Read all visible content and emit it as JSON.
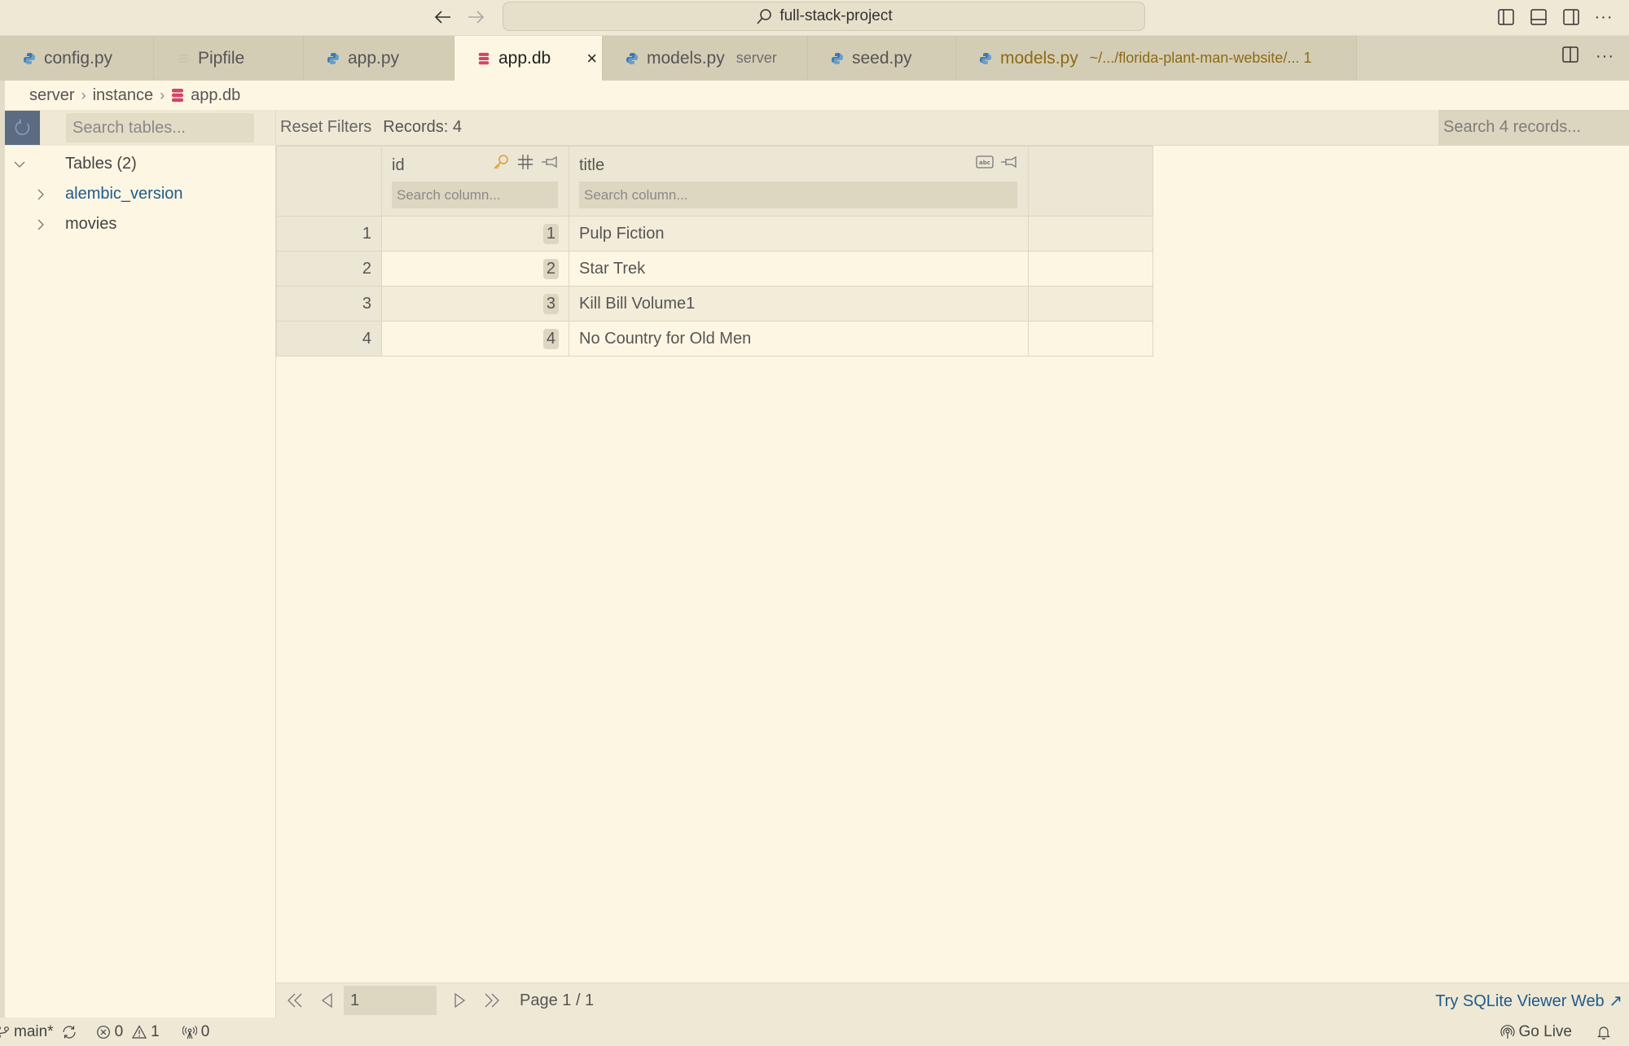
{
  "titlebar": {
    "search_text": "full-stack-project"
  },
  "tabs": [
    {
      "label": "config.py",
      "icon": "python-icon",
      "active": false
    },
    {
      "label": "Pipfile",
      "icon": "file-lines-icon",
      "active": false
    },
    {
      "label": "app.py",
      "icon": "python-icon",
      "active": false
    },
    {
      "label": "app.db",
      "icon": "database-icon",
      "active": true,
      "close": "×"
    },
    {
      "label": "models.py",
      "sub": "server",
      "icon": "python-icon",
      "active": false
    },
    {
      "label": "seed.py",
      "icon": "python-icon",
      "active": false
    },
    {
      "label": "models.py",
      "sub": "~/.../florida-plant-man-website/... 1",
      "icon": "python-icon",
      "active": false,
      "modified": true
    }
  ],
  "breadcrumb": [
    "server",
    "instance",
    "app.db"
  ],
  "sidebar": {
    "search_placeholder": "Search tables...",
    "tables_header": "Tables (2)",
    "tables": [
      {
        "name": "alembic_version",
        "selected": true
      },
      {
        "name": "movies",
        "selected": false
      }
    ]
  },
  "toolbar": {
    "reset_label": "Reset Filters",
    "records_label": "Records: 4",
    "search_placeholder": "Search 4 records..."
  },
  "grid": {
    "columns": [
      {
        "name": "id",
        "icons": [
          "key-icon",
          "hash-icon",
          "pin-icon"
        ],
        "search_placeholder": "Search column..."
      },
      {
        "name": "title",
        "icons": [
          "text-type-icon",
          "pin-icon"
        ],
        "search_placeholder": "Search column..."
      }
    ],
    "rows": [
      {
        "rownum": "1",
        "id": "1",
        "title": "Pulp Fiction"
      },
      {
        "rownum": "2",
        "id": "2",
        "title": "Star Trek"
      },
      {
        "rownum": "3",
        "id": "3",
        "title": "Kill Bill Volume1"
      },
      {
        "rownum": "4",
        "id": "4",
        "title": "No Country for Old Men"
      }
    ]
  },
  "pager": {
    "page_value": "1",
    "page_label": "Page 1 / 1",
    "try_link": "Try SQLite Viewer Web ↗"
  },
  "statusbar": {
    "branch": "main*",
    "errors": "0",
    "warnings": "1",
    "ports": "0",
    "go_live": "Go Live"
  },
  "colors": {
    "accent_link": "#1f5b8b",
    "db_icon": "#d0476b",
    "python_icon": "#3a7ab3",
    "modified_tab": "#8b6b14",
    "key_icon": "#e0a030"
  }
}
